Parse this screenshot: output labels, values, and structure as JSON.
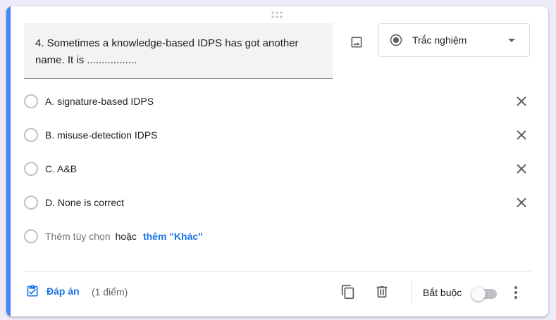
{
  "question": {
    "text": "4. Sometimes a knowledge-based IDPS has got another name. It is .................",
    "type_label": "Trắc nghiệm"
  },
  "options": [
    {
      "label": "A. signature-based IDPS"
    },
    {
      "label": "B. misuse-detection IDPS"
    },
    {
      "label": "C. A&B"
    },
    {
      "label": "D. None is correct"
    }
  ],
  "add_option": {
    "text": "Thêm tùy chọn",
    "or": "hoặc",
    "other": "thêm \"Khác\""
  },
  "footer": {
    "answer_key": "Đáp án",
    "points": "(1 điểm)",
    "required_label": "Bắt buộc",
    "required": false
  },
  "colors": {
    "accent": "#4285f4",
    "link": "#1a73e8"
  },
  "icons": [
    "drag-handle-icon",
    "image-icon",
    "radio-button-icon",
    "dropdown-caret-icon",
    "close-icon",
    "answer-key-icon",
    "duplicate-icon",
    "delete-icon",
    "more-vert-icon"
  ]
}
